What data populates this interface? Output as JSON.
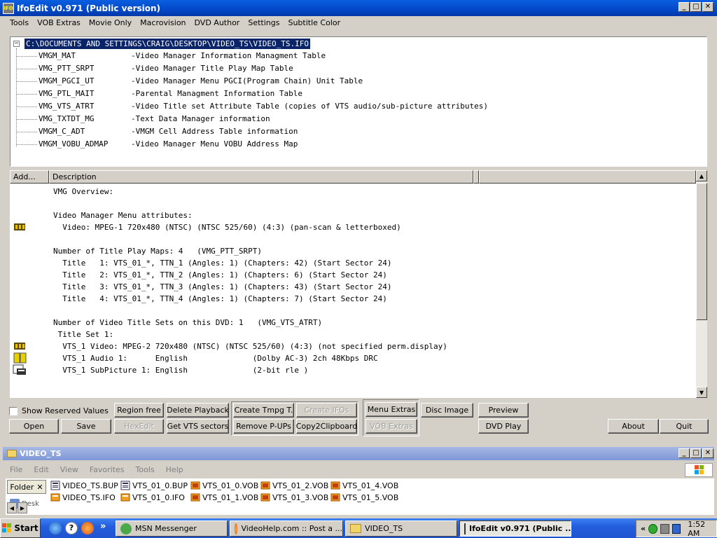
{
  "window": {
    "title": "IfoEdit v0.971 (Public version)"
  },
  "menu": [
    "Tools",
    "VOB Extras",
    "Movie Only",
    "Macrovision",
    "DVD Author",
    "Settings",
    "Subtitle Color"
  ],
  "tree": {
    "expander": "−",
    "root": "C:\\DOCUMENTS AND SETTINGS\\CRAIG\\DESKTOP\\VIDEO_TS\\VIDEO_TS.IFO",
    "items": [
      {
        "name": "VMGM_MAT",
        "desc": "-Video Manager Information Managment Table"
      },
      {
        "name": "VMG_PTT_SRPT",
        "desc": "-Video Manager Title Play Map Table"
      },
      {
        "name": "VMGM_PGCI_UT",
        "desc": "-Video Manager Menu PGCI(Program Chain) Unit Table"
      },
      {
        "name": "VMG_PTL_MAIT",
        "desc": "-Parental Managment Information Table"
      },
      {
        "name": "VMG_VTS_ATRT",
        "desc": "-Video Title set Attribute Table (copies of VTS audio/sub-picture attributes)"
      },
      {
        "name": "VMG_TXTDT_MG",
        "desc": "-Text Data Manager information"
      },
      {
        "name": "VMGM_C_ADT",
        "desc": "-VMGM Cell Address Table information"
      },
      {
        "name": "VMGM_VOBU_ADMAP",
        "desc": "-Video Manager Menu VOBU Address Map"
      }
    ]
  },
  "list": {
    "col_address": "Add...",
    "col_description": "Description",
    "rows": [
      {
        "text": "VMG Overview:",
        "icon": ""
      },
      {
        "text": "",
        "icon": ""
      },
      {
        "text": "Video Manager Menu attributes:",
        "icon": ""
      },
      {
        "text": "  Video: MPEG-1 720x480 (NTSC) (NTSC 525/60) (4:3) (pan-scan & letterboxed)",
        "icon": "video"
      },
      {
        "text": "",
        "icon": ""
      },
      {
        "text": "Number of Title Play Maps: 4   (VMG_PTT_SRPT)",
        "icon": ""
      },
      {
        "text": "  Title   1: VTS_01_*, TTN_1 (Angles: 1) (Chapters: 42) (Start Sector 24)",
        "icon": ""
      },
      {
        "text": "  Title   2: VTS_01_*, TTN_2 (Angles: 1) (Chapters: 6) (Start Sector 24)",
        "icon": ""
      },
      {
        "text": "  Title   3: VTS_01_*, TTN_3 (Angles: 1) (Chapters: 43) (Start Sector 24)",
        "icon": ""
      },
      {
        "text": "  Title   4: VTS_01_*, TTN_4 (Angles: 1) (Chapters: 7) (Start Sector 24)",
        "icon": ""
      },
      {
        "text": "",
        "icon": ""
      },
      {
        "text": "Number of Video Title Sets on this DVD: 1   (VMG_VTS_ATRT)",
        "icon": ""
      },
      {
        "text": " Title Set 1:",
        "icon": ""
      },
      {
        "text": "  VTS_1 Video: MPEG-2 720x480 (NTSC) (NTSC 525/60) (4:3) (not specified perm.display)",
        "icon": "video"
      },
      {
        "text": "  VTS_1 Audio 1:      English              (Dolby AC-3) 2ch 48Kbps DRC",
        "icon": "audio"
      },
      {
        "text": "  VTS_1 SubPicture 1: English              (2-bit rle )",
        "icon": "subpic"
      }
    ]
  },
  "controls": {
    "show_reserved": "Show Reserved Values",
    "region_free": "Region free",
    "delete_playback": "Delete Playback",
    "create_tmpg": "Create Tmpg T.",
    "create_ifos": "Create IFOs",
    "menu_extras": "Menu Extras",
    "disc_image": "Disc Image",
    "preview": "Preview",
    "open": "Open",
    "save": "Save",
    "hexedit": "HexEdit",
    "get_vts": "Get VTS sectors",
    "remove_pups": "Remove P-UPs",
    "copy2clip": "Copy2Clipboard",
    "vob_extras": "VOB Extras",
    "dvd_play": "DVD Play",
    "about": "About",
    "quit": "Quit"
  },
  "explorer": {
    "title": "VIDEO_TS",
    "menu": [
      "File",
      "Edit",
      "View",
      "Favorites",
      "Tools",
      "Help"
    ],
    "folders_label": "Folder",
    "desktop_label": "Desk",
    "files": [
      {
        "name": "VIDEO_TS.BUP",
        "type": "bup"
      },
      {
        "name": "VIDEO_TS.IFO",
        "type": "ifo"
      },
      {
        "name": "VTS_01_0.BUP",
        "type": "bup"
      },
      {
        "name": "VTS_01_0.IFO",
        "type": "ifo"
      },
      {
        "name": "VTS_01_0.VOB",
        "type": "vob"
      },
      {
        "name": "VTS_01_1.VOB",
        "type": "vob"
      },
      {
        "name": "VTS_01_2.VOB",
        "type": "vob"
      },
      {
        "name": "VTS_01_3.VOB",
        "type": "vob"
      },
      {
        "name": "VTS_01_4.VOB",
        "type": "vob"
      },
      {
        "name": "VTS_01_5.VOB",
        "type": "vob"
      }
    ]
  },
  "taskbar": {
    "start": "Start",
    "tasks": [
      "MSN Messenger",
      "VideoHelp.com :: Post a ...",
      "VIDEO_TS",
      "IfoEdit v0.971 (Public ..."
    ],
    "clock": "1:52 AM",
    "chevron": "«",
    "quick_chevron": "»"
  },
  "window_buttons": {
    "min": "_",
    "max": "□",
    "close": "✕"
  }
}
